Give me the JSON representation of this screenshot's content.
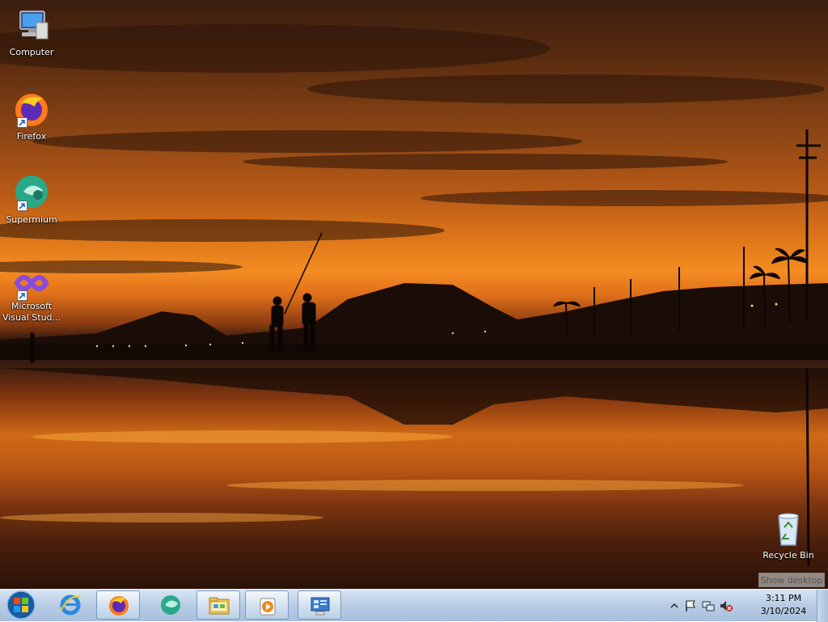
{
  "desktop": {
    "icons": [
      {
        "label": "Computer",
        "icon": "computer-icon",
        "shortcut": false
      },
      {
        "label": "Firefox",
        "icon": "firefox-icon",
        "shortcut": true
      },
      {
        "label": "Supermium",
        "icon": "supermium-icon",
        "shortcut": true
      },
      {
        "label": "Microsoft Visual Stud...",
        "icon": "visual-studio-icon",
        "shortcut": true
      },
      {
        "label": "Recycle Bin",
        "icon": "recycle-bin-icon",
        "shortcut": false
      }
    ],
    "wallpaper": "sunset-beach-fishermen"
  },
  "taskbar": {
    "start_icon": "windows-start-orb",
    "buttons": [
      {
        "name": "internet-explorer",
        "icon": "internet-explorer-icon",
        "open": false
      },
      {
        "name": "firefox",
        "icon": "firefox-icon",
        "open": true
      },
      {
        "name": "supermium",
        "icon": "supermium-icon",
        "open": false
      },
      {
        "name": "windows-explorer",
        "icon": "folder-icon",
        "open": true
      },
      {
        "name": "media-player",
        "icon": "media-player-icon",
        "open": true
      },
      {
        "name": "control-panel",
        "icon": "control-panel-icon",
        "open": true
      }
    ],
    "tray": {
      "icons": [
        "show-hidden-icons-chevron",
        "action-center-flag-icon",
        "network-icon",
        "volume-muted-icon"
      ],
      "time": "3:11 PM",
      "date": "3/10/2024"
    },
    "tooltip": "Show desktop"
  },
  "colors": {
    "sky_hot": "#f48c22",
    "sky_dark": "#3a1e0e",
    "taskbar": "#b8cce4"
  }
}
